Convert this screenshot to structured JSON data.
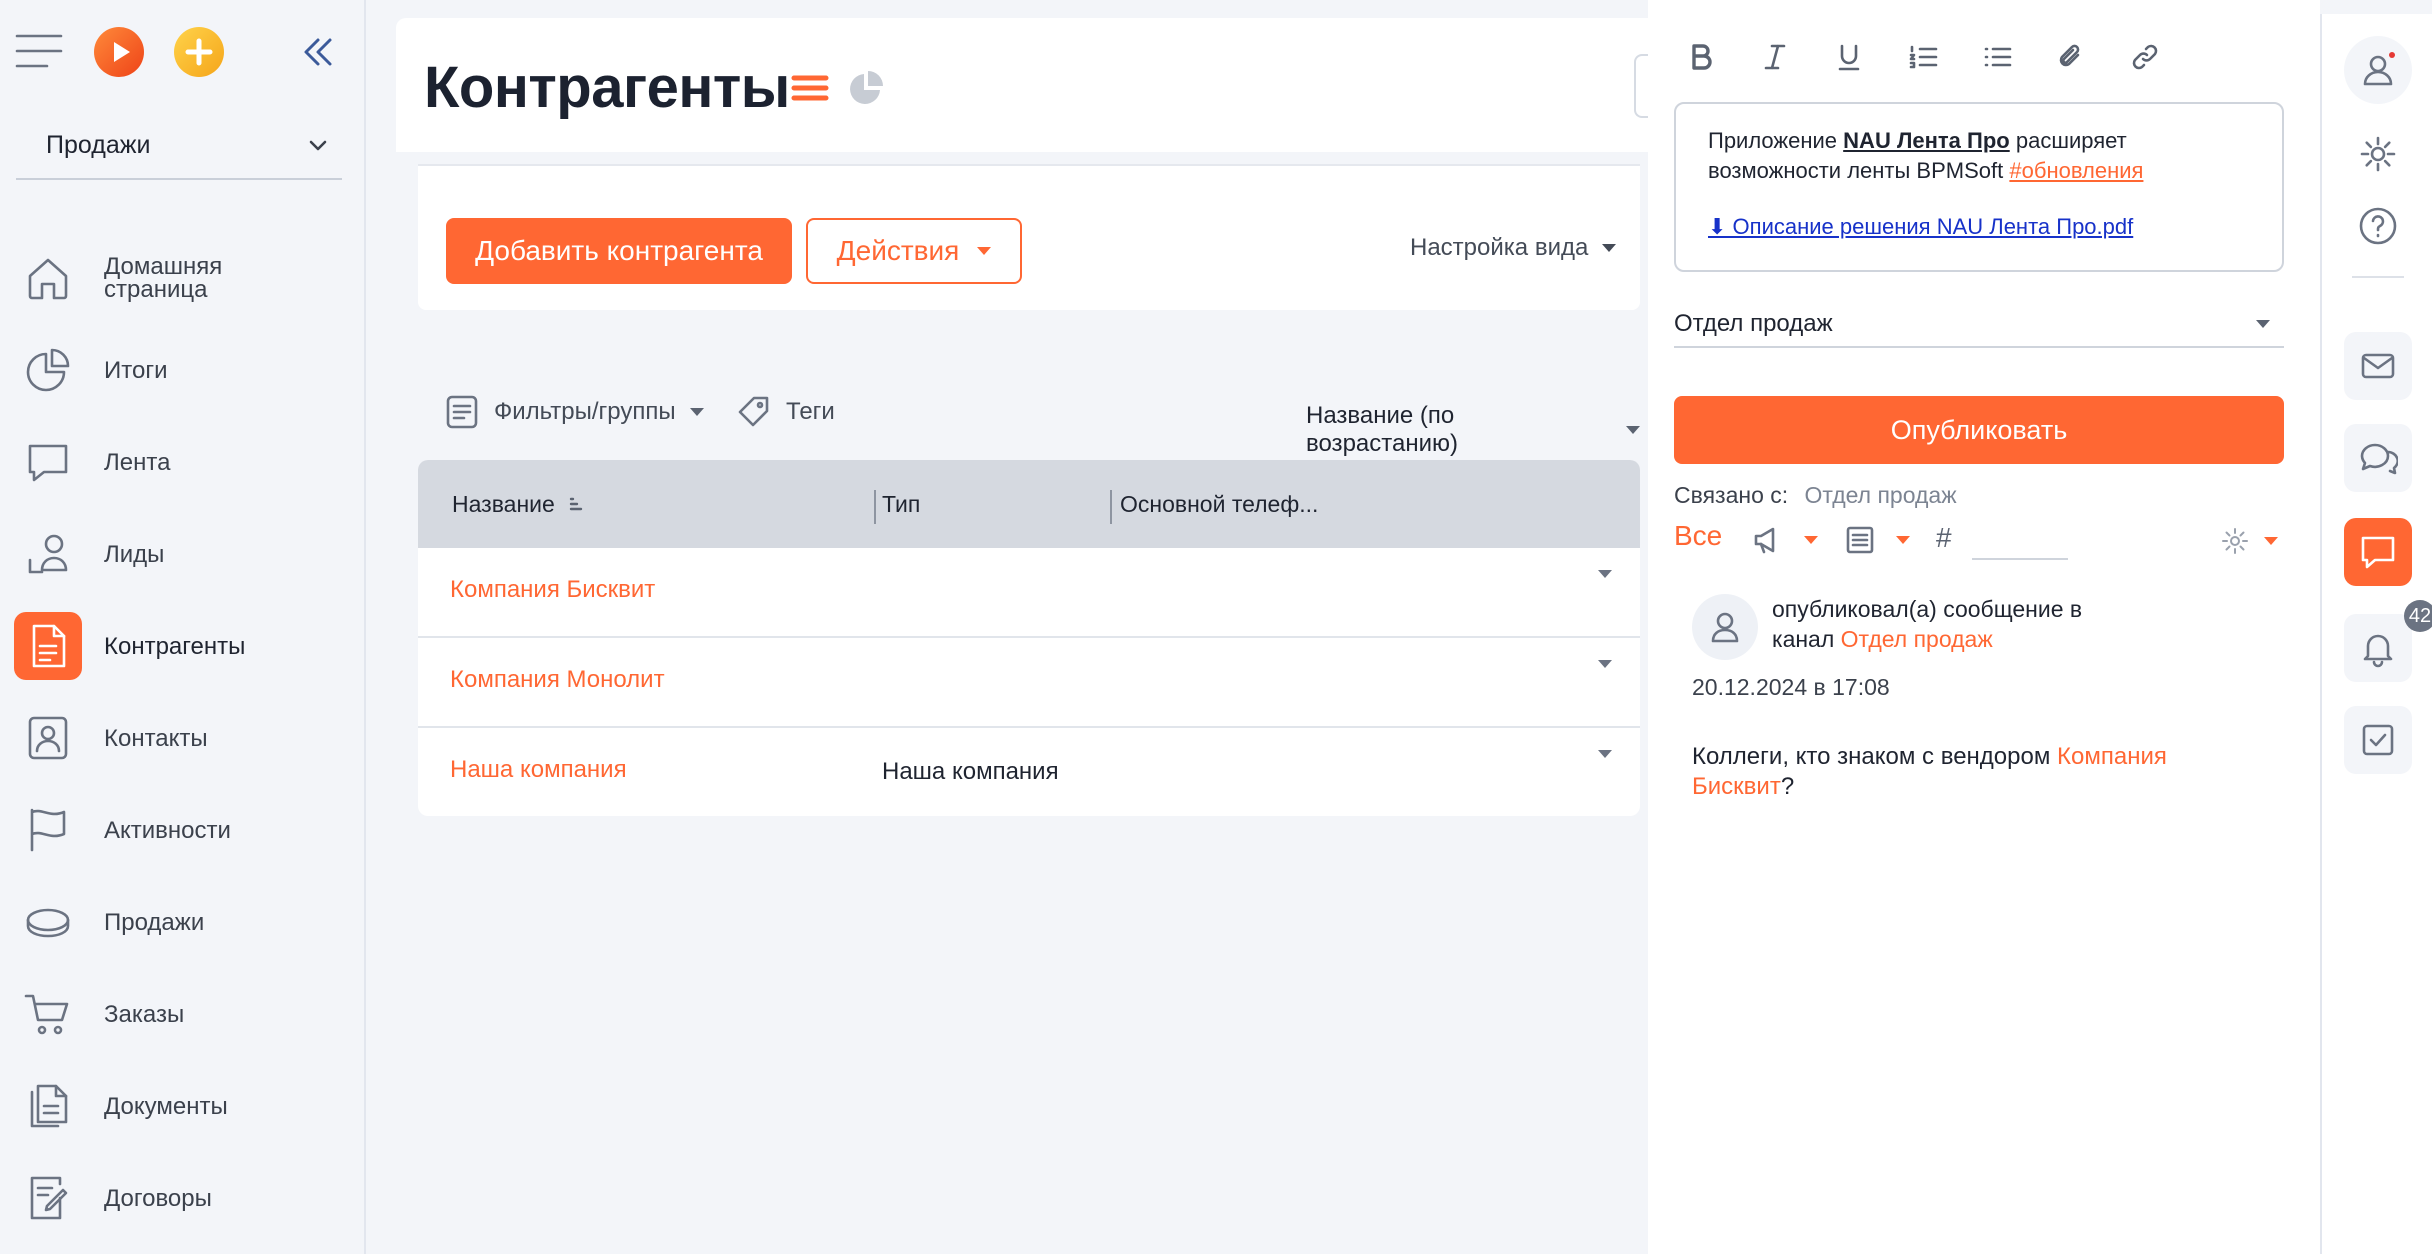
{
  "sidebar": {
    "workspace": "Продажи",
    "items": [
      {
        "label": "Домашняя страница",
        "icon": "home-icon"
      },
      {
        "label": "Итоги",
        "icon": "pie-chart-icon"
      },
      {
        "label": "Лента",
        "icon": "chat-bubble-icon"
      },
      {
        "label": "Лиды",
        "icon": "leads-icon"
      },
      {
        "label": "Контрагенты",
        "icon": "document-icon",
        "active": true
      },
      {
        "label": "Контакты",
        "icon": "contact-card-icon"
      },
      {
        "label": "Активности",
        "icon": "flag-icon"
      },
      {
        "label": "Продажи",
        "icon": "coin-icon"
      },
      {
        "label": "Заказы",
        "icon": "cart-icon"
      },
      {
        "label": "Документы",
        "icon": "documents-icon"
      },
      {
        "label": "Договоры",
        "icon": "contract-icon"
      }
    ]
  },
  "page": {
    "title": "Контрагенты",
    "add_button": "Добавить контрагента",
    "actions_button": "Действия",
    "view_settings": "Настройка вида",
    "filters": "Фильтры/группы",
    "tags": "Теги",
    "sort": "Название (по возрастанию)"
  },
  "table": {
    "columns": [
      "Название",
      "Тип",
      "Основной телеф..."
    ],
    "rows": [
      {
        "name": "Компания Бисквит",
        "type": ""
      },
      {
        "name": "Компания Монолит",
        "type": ""
      },
      {
        "name": "Наша компания",
        "type": "Наша компания"
      }
    ]
  },
  "feed": {
    "editor": {
      "text_before": "Приложение",
      "bold": "NAU Лента Про",
      "text_after": "расширяет возможности ленты BPMSoft",
      "hashtag": "#обновления",
      "file": "⬇ Описание решения NAU Лента Про.pdf"
    },
    "channel": "Отдел продаж",
    "publish": "Опубликовать",
    "linked_label": "Связано с:",
    "linked_value": "Отдел продаж",
    "filter_all": "Все",
    "hash_symbol": "#",
    "post": {
      "head": "опубликовал(а) сообщение в канал",
      "channel": "Отдел продаж",
      "date": "20.12.2024 в 17:08",
      "body_before": "Коллеги, кто знаком с вендором",
      "body_link": "Компания Бисквит",
      "body_after": "?"
    }
  },
  "rail": {
    "notifications_count": "42"
  },
  "colors": {
    "accent": "#ff6733",
    "sidebar_bg": "#f3f5f9",
    "table_header": "#d5d9e0"
  }
}
